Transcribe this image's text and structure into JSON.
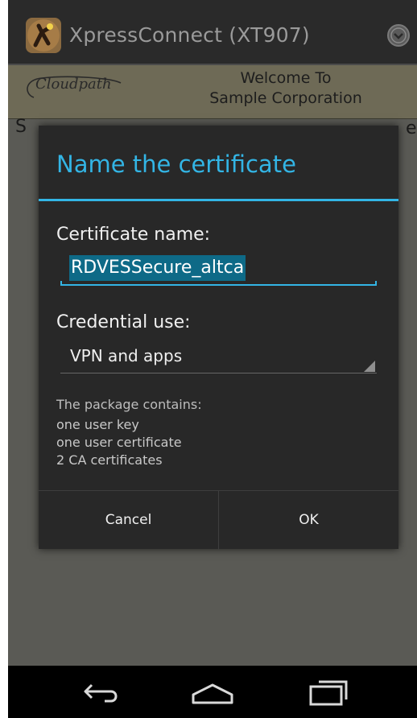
{
  "app_bar": {
    "title": "XpressConnect  (XT907)",
    "menu_icon": "circle-chevron-down-icon",
    "logo_icon": "xpressconnect-logo-icon"
  },
  "header": {
    "brand": "Cloudpath",
    "welcome_line1": "Welcome To",
    "welcome_line2": "Sample Corporation"
  },
  "background": {
    "visible_char_left": "S",
    "visible_char_right": "e."
  },
  "dialog": {
    "title": "Name the certificate",
    "cert_name_label": "Certificate name:",
    "cert_name_value": "RDVESSecure_altca",
    "credential_label": "Credential use:",
    "credential_value": "VPN and apps",
    "package_header": "The package contains:",
    "package_items": [
      "one user key",
      "one user certificate",
      "2 CA certificates"
    ],
    "cancel_label": "Cancel",
    "ok_label": "OK"
  },
  "nav_bar": {
    "back_icon": "back-arrow-icon",
    "home_icon": "home-icon",
    "recents_icon": "recent-apps-icon"
  },
  "colors": {
    "accent": "#33b5e5",
    "dialog_bg": "#282828",
    "selection": "#0e6a87"
  }
}
